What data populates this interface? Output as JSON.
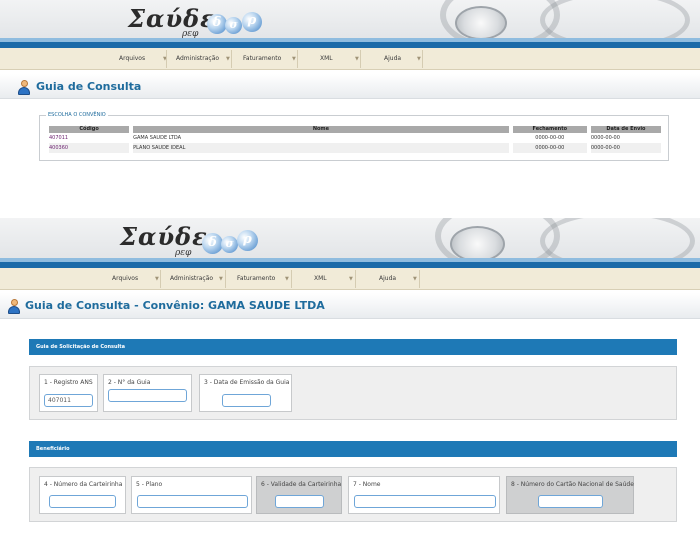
{
  "logo": {
    "name": "Σαύδε",
    "sub": "ρεφ",
    "symbols": [
      "δ",
      "σ",
      "ρ"
    ]
  },
  "menu": [
    "Arquivos",
    "Administração",
    "Faturamento",
    "XML",
    "Ajuda"
  ],
  "page1": {
    "title": "Guia de Consulta",
    "fieldset_legend": "ESCOLHA O CONVÊNIO",
    "columns": [
      "Código",
      "Nome",
      "Fechamento",
      "Data de Envio"
    ],
    "rows": [
      {
        "codigo": "407011",
        "nome": "GAMA SAUDE LTDA",
        "fechamento": "0000-00-00",
        "envio": "0000-00-00"
      },
      {
        "codigo": "400360",
        "nome": "PLANO SAUDE IDEAL",
        "fechamento": "0000-00-00",
        "envio": "0000-00-00"
      }
    ]
  },
  "page2": {
    "title": "Guia de Consulta - Convênio: GAMA SAUDE LTDA",
    "section1": {
      "header": "Guia de Solicitação de Consulta",
      "fields": [
        {
          "label": "1 - Registro ANS",
          "value": "407011"
        },
        {
          "label": "2 - N° da Guia",
          "value": ""
        },
        {
          "label": "3 - Data de Emissão da Guia",
          "value": ""
        }
      ]
    },
    "section2": {
      "header": "Beneficiário",
      "fields": [
        {
          "label": "4 - Número da Carteirinha",
          "value": ""
        },
        {
          "label": "5 - Plano",
          "value": ""
        },
        {
          "label": "6 - Validade da Carteirinha",
          "value": ""
        },
        {
          "label": "7 - Nome",
          "value": ""
        },
        {
          "label": "8 - Número do Cartão Nacional de Saúde",
          "value": ""
        }
      ]
    }
  }
}
